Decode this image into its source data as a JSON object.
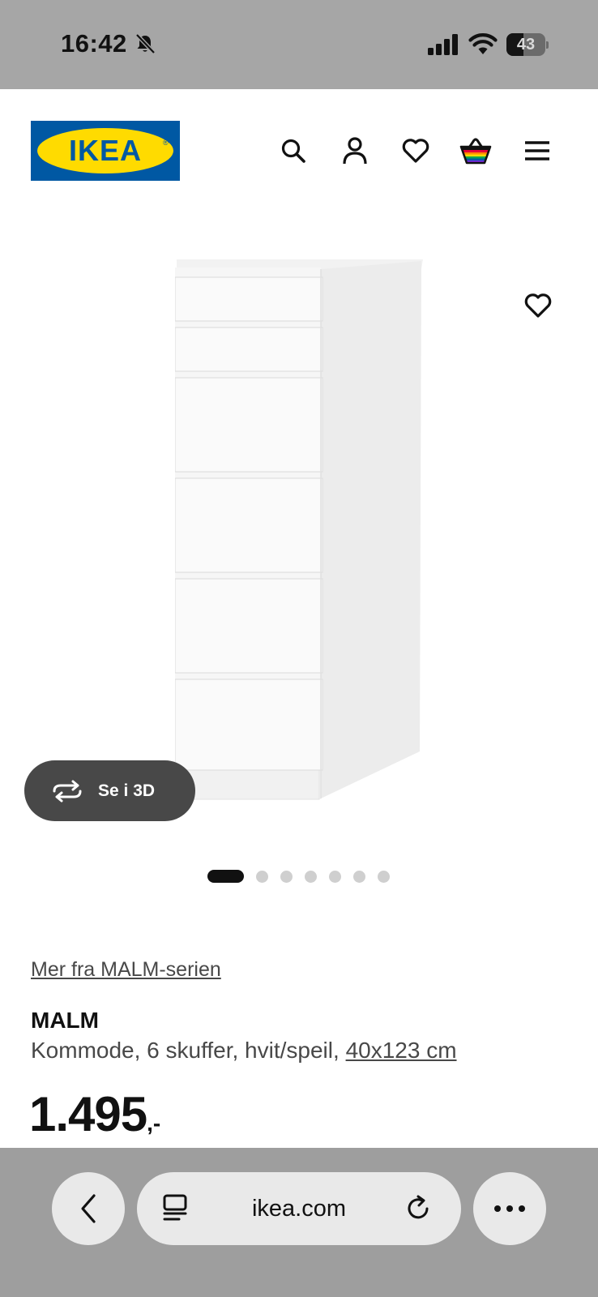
{
  "status_bar": {
    "time": "16:42",
    "battery_percent": "43",
    "battery_level": 0.43
  },
  "header": {
    "logo_text": "IKEA",
    "logo_colors": {
      "blue": "#0058a3",
      "yellow": "#ffdb00"
    },
    "icons": [
      "search-icon",
      "account-icon",
      "favourites-icon",
      "shopping-bag-icon",
      "menu-icon"
    ]
  },
  "gallery": {
    "button_3d_label": "Se i 3D",
    "image_count": 7,
    "active_index": 0
  },
  "product": {
    "series_link": "Mer fra MALM-serien",
    "name": "MALM",
    "description": "Kommode, 6 skuffer, hvit/speil,",
    "size_link": "40x123 cm",
    "price": "1.495",
    "price_suffix": ",-"
  },
  "browser": {
    "url": "ikea.com"
  }
}
